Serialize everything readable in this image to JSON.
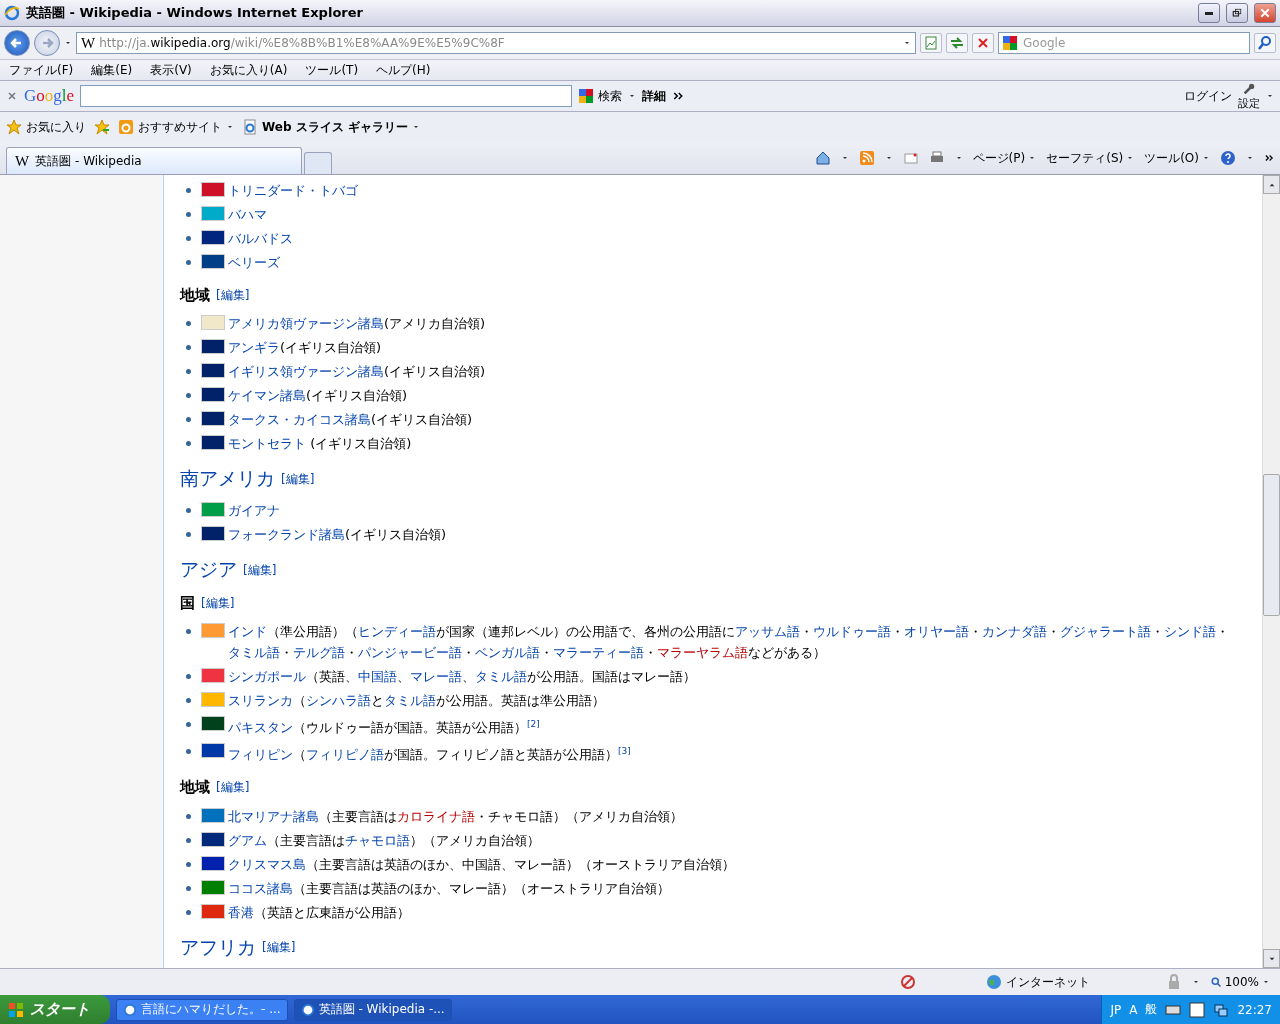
{
  "window": {
    "title": "英語圏 - Wikipedia - Windows Internet Explorer"
  },
  "address": {
    "favicon": "W",
    "scheme": "http://ja.",
    "domain": "wikipedia.org",
    "path": "/wiki/%E8%8B%B1%E8%AA%9E%E5%9C%8F"
  },
  "search": {
    "placeholder": "Google"
  },
  "menu": [
    "ファイル(F)",
    "編集(E)",
    "表示(V)",
    "お気に入り(A)",
    "ツール(T)",
    "ヘルプ(H)"
  ],
  "google_toolbar": {
    "logo": "Google",
    "search_button": "検索",
    "more": "詳細",
    "login": "ログイン",
    "settings": "設定"
  },
  "favorites_bar": {
    "favorites": "お気に入り",
    "suggested": "おすすめサイト",
    "web_slice": "Web スライス ギャラリー"
  },
  "tabs": [
    {
      "favicon": "W",
      "label": "英語圏 - Wikipedia",
      "selected": true
    }
  ],
  "command_bar": [
    "ページ(P)",
    "セーフティ(S)",
    "ツール(O)"
  ],
  "content": [
    {
      "kind": "list",
      "items": [
        {
          "color": "#ce1126",
          "parts": [
            {
              "kind": "link",
              "text": "トリニダード・トバゴ"
            }
          ]
        },
        {
          "color": "#00abc9",
          "parts": [
            {
              "kind": "link",
              "text": "バハマ"
            }
          ]
        },
        {
          "color": "#00267f",
          "parts": [
            {
              "kind": "link",
              "text": "バルバドス"
            }
          ]
        },
        {
          "color": "#003f87",
          "parts": [
            {
              "kind": "link",
              "text": "ベリーズ"
            }
          ]
        }
      ]
    },
    {
      "kind": "h3",
      "text": "地域",
      "edit": "[編集]"
    },
    {
      "kind": "list",
      "items": [
        {
          "color": "#f0e8c8",
          "parts": [
            {
              "kind": "link",
              "text": "アメリカ領ヴァージン諸島"
            },
            {
              "kind": "plain",
              "text": "(アメリカ自治領)"
            }
          ]
        },
        {
          "color": "#012169",
          "parts": [
            {
              "kind": "link",
              "text": "アンギラ"
            },
            {
              "kind": "plain",
              "text": "(イギリス自治領)"
            }
          ]
        },
        {
          "color": "#012169",
          "parts": [
            {
              "kind": "link",
              "text": "イギリス領ヴァージン諸島"
            },
            {
              "kind": "plain",
              "text": "(イギリス自治領)"
            }
          ]
        },
        {
          "color": "#012169",
          "parts": [
            {
              "kind": "link",
              "text": "ケイマン諸島"
            },
            {
              "kind": "plain",
              "text": "(イギリス自治領)"
            }
          ]
        },
        {
          "color": "#012169",
          "parts": [
            {
              "kind": "link",
              "text": "タークス・カイコス諸島"
            },
            {
              "kind": "plain",
              "text": "(イギリス自治領)"
            }
          ]
        },
        {
          "color": "#012169",
          "parts": [
            {
              "kind": "link",
              "text": "モントセラト"
            },
            {
              "kind": "plain",
              "text": " (イギリス自治領)"
            }
          ]
        }
      ]
    },
    {
      "kind": "h2",
      "text": "南アメリカ",
      "edit": "[編集]"
    },
    {
      "kind": "list",
      "items": [
        {
          "color": "#009e49",
          "parts": [
            {
              "kind": "link",
              "text": "ガイアナ"
            }
          ]
        },
        {
          "color": "#012169",
          "parts": [
            {
              "kind": "link",
              "text": "フォークランド諸島"
            },
            {
              "kind": "plain",
              "text": "(イギリス自治領)"
            }
          ]
        }
      ]
    },
    {
      "kind": "h2",
      "text": "アジア",
      "edit": "[編集]"
    },
    {
      "kind": "h3",
      "text": "国",
      "edit": "[編集]"
    },
    {
      "kind": "list",
      "items": [
        {
          "color": "#ff9933",
          "parts": [
            {
              "kind": "link",
              "text": "インド"
            },
            {
              "kind": "plain",
              "text": "（準公用語）（"
            },
            {
              "kind": "link",
              "text": "ヒンディー語"
            },
            {
              "kind": "plain",
              "text": "が国家（連邦レベル）の公用語で、各州の公用語に"
            },
            {
              "kind": "link",
              "text": "アッサム語"
            },
            {
              "kind": "plain",
              "text": "・"
            },
            {
              "kind": "link",
              "text": "ウルドゥー語"
            },
            {
              "kind": "plain",
              "text": "・"
            },
            {
              "kind": "link",
              "text": "オリヤー語"
            },
            {
              "kind": "plain",
              "text": "・"
            },
            {
              "kind": "link",
              "text": "カンナダ語"
            },
            {
              "kind": "plain",
              "text": "・"
            },
            {
              "kind": "link",
              "text": "グジャラート語"
            },
            {
              "kind": "plain",
              "text": "・"
            },
            {
              "kind": "link",
              "text": "シンド語"
            },
            {
              "kind": "plain",
              "text": "・"
            },
            {
              "kind": "link",
              "text": "タミル語"
            },
            {
              "kind": "plain",
              "text": "・"
            },
            {
              "kind": "link",
              "text": "テルグ語"
            },
            {
              "kind": "plain",
              "text": "・"
            },
            {
              "kind": "link",
              "text": "パンジャービー語"
            },
            {
              "kind": "plain",
              "text": "・"
            },
            {
              "kind": "link",
              "text": "ベンガル語"
            },
            {
              "kind": "plain",
              "text": "・"
            },
            {
              "kind": "link",
              "text": "マラーティー語"
            },
            {
              "kind": "plain",
              "text": "・"
            },
            {
              "kind": "redlink",
              "text": "マラーヤラム語"
            },
            {
              "kind": "plain",
              "text": "などがある）"
            }
          ]
        },
        {
          "color": "#ef3340",
          "parts": [
            {
              "kind": "link",
              "text": "シンガポール"
            },
            {
              "kind": "plain",
              "text": "（英語、"
            },
            {
              "kind": "link",
              "text": "中国語"
            },
            {
              "kind": "plain",
              "text": "、"
            },
            {
              "kind": "link",
              "text": "マレー語"
            },
            {
              "kind": "plain",
              "text": "、"
            },
            {
              "kind": "link",
              "text": "タミル語"
            },
            {
              "kind": "plain",
              "text": "が公用語。国語はマレー語）"
            }
          ]
        },
        {
          "color": "#ffb700",
          "parts": [
            {
              "kind": "link",
              "text": "スリランカ"
            },
            {
              "kind": "plain",
              "text": "（"
            },
            {
              "kind": "link",
              "text": "シンハラ語"
            },
            {
              "kind": "plain",
              "text": "と"
            },
            {
              "kind": "link",
              "text": "タミル語"
            },
            {
              "kind": "plain",
              "text": "が公用語。英語は準公用語）"
            }
          ]
        },
        {
          "color": "#01411c",
          "parts": [
            {
              "kind": "link",
              "text": "パキスタン"
            },
            {
              "kind": "plain",
              "text": "（ウルドゥー語が国語。英語が公用語）"
            },
            {
              "kind": "ref",
              "text": "[2]"
            }
          ]
        },
        {
          "color": "#0038a8",
          "parts": [
            {
              "kind": "link",
              "text": "フィリピン"
            },
            {
              "kind": "plain",
              "text": "（"
            },
            {
              "kind": "link",
              "text": "フィリピノ語"
            },
            {
              "kind": "plain",
              "text": "が国語。フィリピノ語と英語が公用語）"
            },
            {
              "kind": "ref",
              "text": "[3]"
            }
          ]
        }
      ]
    },
    {
      "kind": "h3",
      "text": "地域",
      "edit": "[編集]"
    },
    {
      "kind": "list",
      "items": [
        {
          "color": "#0071bc",
          "parts": [
            {
              "kind": "link",
              "text": "北マリアナ諸島"
            },
            {
              "kind": "plain",
              "text": "（主要言語は"
            },
            {
              "kind": "redlink",
              "text": "カロライナ語"
            },
            {
              "kind": "plain",
              "text": "・チャモロ語）（アメリカ自治領）"
            }
          ]
        },
        {
          "color": "#00297b",
          "parts": [
            {
              "kind": "link",
              "text": "グアム"
            },
            {
              "kind": "plain",
              "text": "（主要言語は"
            },
            {
              "kind": "link",
              "text": "チャモロ語"
            },
            {
              "kind": "plain",
              "text": "）（アメリカ自治領）"
            }
          ]
        },
        {
          "color": "#0021ad",
          "parts": [
            {
              "kind": "link",
              "text": "クリスマス島"
            },
            {
              "kind": "plain",
              "text": "（主要言語は英語のほか、中国語、マレー語）（オーストラリア自治領）"
            }
          ]
        },
        {
          "color": "#008000",
          "parts": [
            {
              "kind": "link",
              "text": "ココス諸島"
            },
            {
              "kind": "plain",
              "text": "（主要言語は英語のほか、マレー語）（オーストラリア自治領）"
            }
          ]
        },
        {
          "color": "#de2910",
          "parts": [
            {
              "kind": "link",
              "text": "香港"
            },
            {
              "kind": "plain",
              "text": "（英語と広東語が公用語）"
            }
          ]
        }
      ]
    },
    {
      "kind": "h2",
      "text": "アフリカ",
      "edit": "[編集]"
    }
  ],
  "status_bar": {
    "zone": "インターネット",
    "zoom": "100%"
  },
  "taskbar": {
    "start": "スタート",
    "tasks": [
      {
        "label": "言語にハマりだした。- ...",
        "selected": false
      },
      {
        "label": "英語圏 - Wikipedia -...",
        "selected": true
      }
    ],
    "tray": [
      "JP",
      "A",
      "般"
    ],
    "clock": "22:27"
  }
}
